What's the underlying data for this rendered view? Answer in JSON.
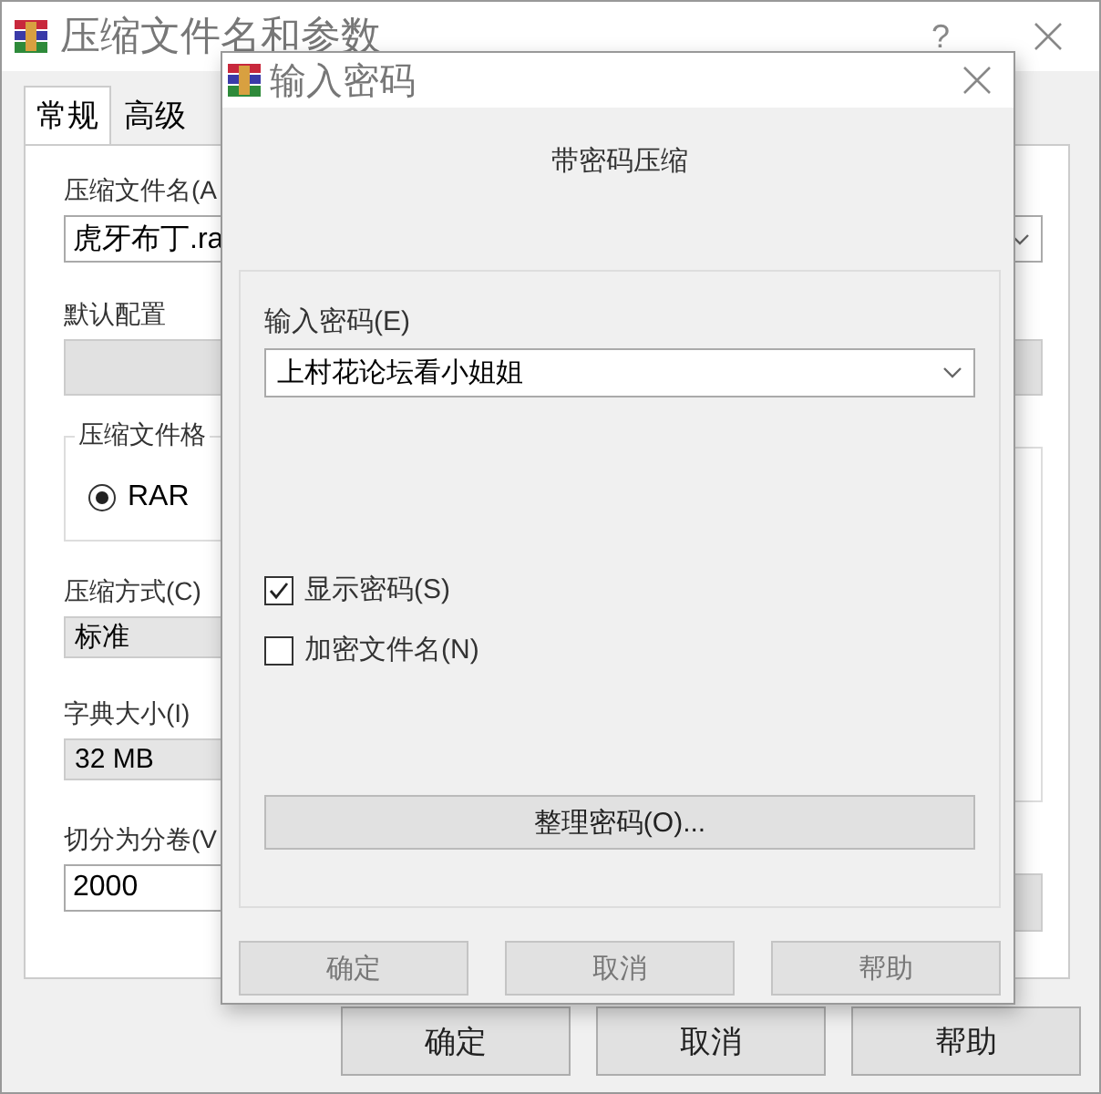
{
  "main_window": {
    "title": "压缩文件名和参数",
    "help": "?",
    "tabs": [
      {
        "label": "常规",
        "selected": true
      },
      {
        "label": "高级",
        "selected": false
      }
    ],
    "archive_name": {
      "label": "压缩文件名(A",
      "value": "虎牙布丁.ra"
    },
    "profile": {
      "label": "默认配置"
    },
    "format_group": {
      "title": "压缩文件格",
      "options": [
        {
          "label": "RAR",
          "selected": true
        }
      ]
    },
    "method": {
      "label": "压缩方式(C)",
      "value": "标准"
    },
    "dictionary": {
      "label": "字典大小(I)",
      "value": "32 MB"
    },
    "split": {
      "label": "切分为分卷(V",
      "value": "2000"
    },
    "buttons": [
      "确定",
      "取消",
      "帮助"
    ]
  },
  "password_dialog": {
    "title": "输入密码",
    "heading": "带密码压缩",
    "password": {
      "label": "输入密码(E)",
      "value": "上村花论坛看小姐姐"
    },
    "options": [
      {
        "label": "显示密码(S)",
        "checked": true
      },
      {
        "label": "加密文件名(N)",
        "checked": false
      }
    ],
    "organize_button": "整理密码(O)...",
    "buttons": [
      "确定",
      "取消",
      "帮助"
    ]
  }
}
